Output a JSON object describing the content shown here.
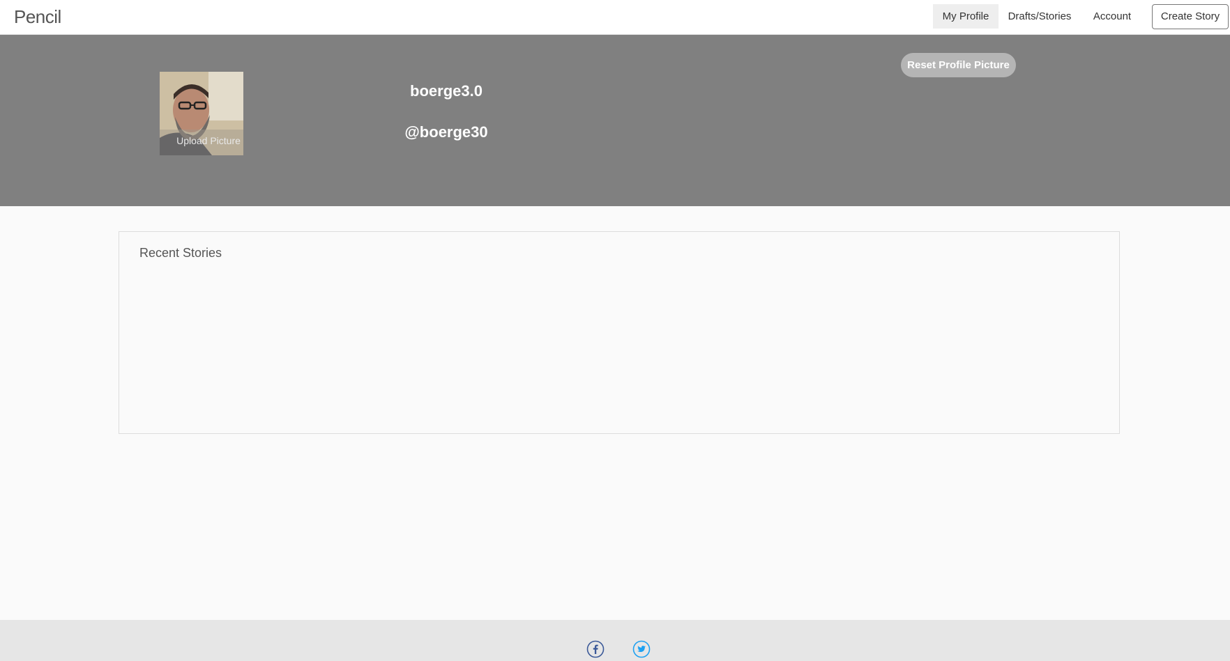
{
  "app": {
    "brand": "Pencil"
  },
  "nav": {
    "my_profile": "My Profile",
    "drafts": "Drafts/Stories",
    "account": "Account",
    "create_story": "Create Story"
  },
  "profile": {
    "display_name": "boerge3.0",
    "handle": "@boerge30",
    "upload_label": "Upload Picture",
    "reset_label": "Reset Profile Picture"
  },
  "stories": {
    "title": "Recent Stories"
  },
  "footer": {
    "icons": [
      "facebook-icon",
      "twitter-icon"
    ]
  },
  "colors": {
    "hero_bg": "#808080",
    "facebook": "#3b5998",
    "twitter": "#1da1f2"
  }
}
